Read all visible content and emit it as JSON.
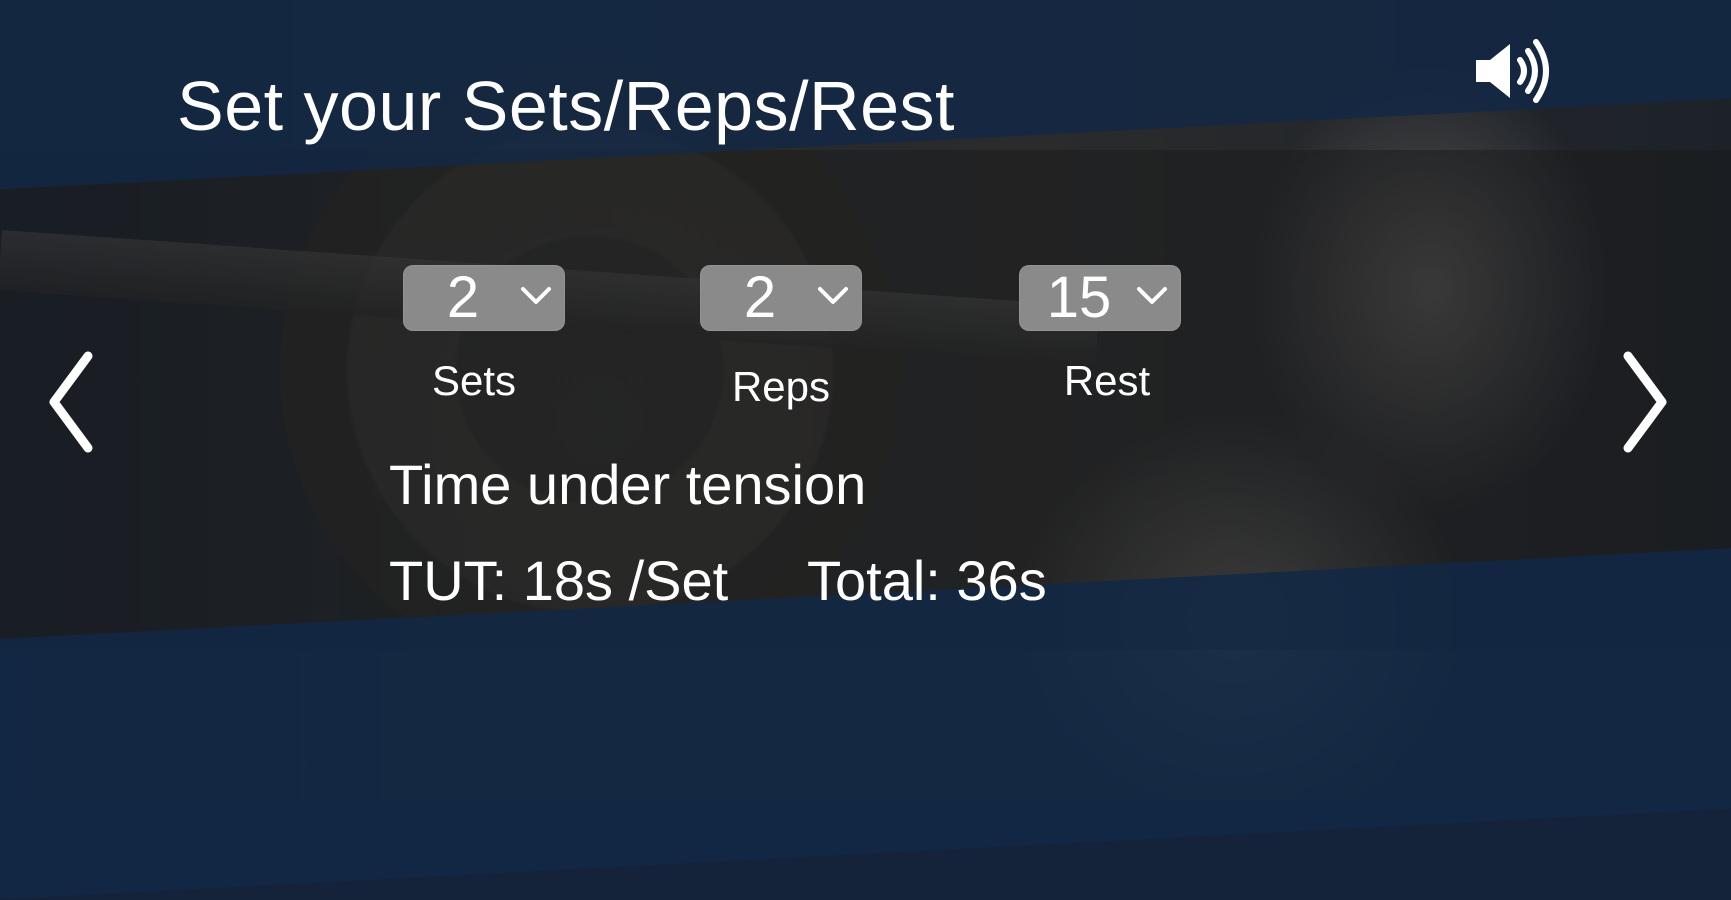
{
  "screen": {
    "title": "Set your Sets/Reps/Rest",
    "sound_icon": "speaker-volume-icon",
    "prev_icon": "chevron-left-icon",
    "next_icon": "chevron-right-icon"
  },
  "pickers": {
    "sets": {
      "value": "2",
      "label": "Sets"
    },
    "reps": {
      "value": "2",
      "label": "Reps"
    },
    "rest": {
      "value": "15",
      "label": "Rest"
    }
  },
  "tut": {
    "heading": "Time under tension",
    "per_set": "TUT: 18s /Set",
    "total": "Total: 36s"
  },
  "colors": {
    "band": "#12284a",
    "picker_bg": "#8a8a8a",
    "text": "#ffffff"
  }
}
